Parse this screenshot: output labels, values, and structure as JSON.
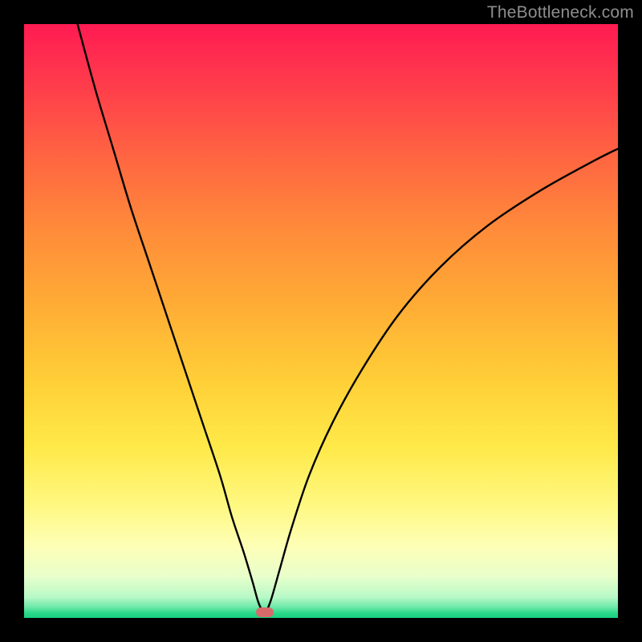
{
  "watermark": "TheBottleneck.com",
  "marker": {
    "x_pct": 40.5,
    "y_pct": 99.1,
    "color": "#d76a6a"
  },
  "chart_data": {
    "type": "line",
    "title": "",
    "xlabel": "",
    "ylabel": "",
    "xlim": [
      0,
      100
    ],
    "ylim": [
      0,
      100
    ],
    "grid": false,
    "legend": false,
    "background_gradient": {
      "orientation": "vertical",
      "stops": [
        {
          "pos": 0.0,
          "color": "#ff1b52"
        },
        {
          "pos": 0.1,
          "color": "#ff3b4c"
        },
        {
          "pos": 0.23,
          "color": "#ff6741"
        },
        {
          "pos": 0.35,
          "color": "#ff8c3a"
        },
        {
          "pos": 0.48,
          "color": "#ffae35"
        },
        {
          "pos": 0.6,
          "color": "#ffcf37"
        },
        {
          "pos": 0.71,
          "color": "#ffe948"
        },
        {
          "pos": 0.81,
          "color": "#fff881"
        },
        {
          "pos": 0.88,
          "color": "#fdffb7"
        },
        {
          "pos": 0.93,
          "color": "#e8ffcb"
        },
        {
          "pos": 0.965,
          "color": "#b8f9c7"
        },
        {
          "pos": 0.982,
          "color": "#6be8a8"
        },
        {
          "pos": 0.992,
          "color": "#2ad989"
        },
        {
          "pos": 1.0,
          "color": "#17d080"
        }
      ]
    },
    "series": [
      {
        "name": "bottleneck-curve",
        "color": "#000000",
        "x": [
          9,
          12,
          15,
          18,
          21,
          24,
          27,
          30,
          33,
          35,
          37,
          38.5,
          39.5,
          40.5,
          41.5,
          43,
          45,
          48,
          52,
          57,
          63,
          70,
          78,
          87,
          96,
          100
        ],
        "y": [
          100,
          89,
          79,
          69,
          60,
          51,
          42,
          33,
          24,
          17,
          11,
          6,
          2.5,
          0.9,
          2.8,
          8,
          15,
          24,
          33,
          42,
          51,
          59,
          66,
          72,
          77,
          79
        ]
      }
    ],
    "markers": [
      {
        "name": "min-point",
        "x": 40.5,
        "y": 0.9,
        "shape": "pill",
        "color": "#d76a6a"
      }
    ]
  }
}
